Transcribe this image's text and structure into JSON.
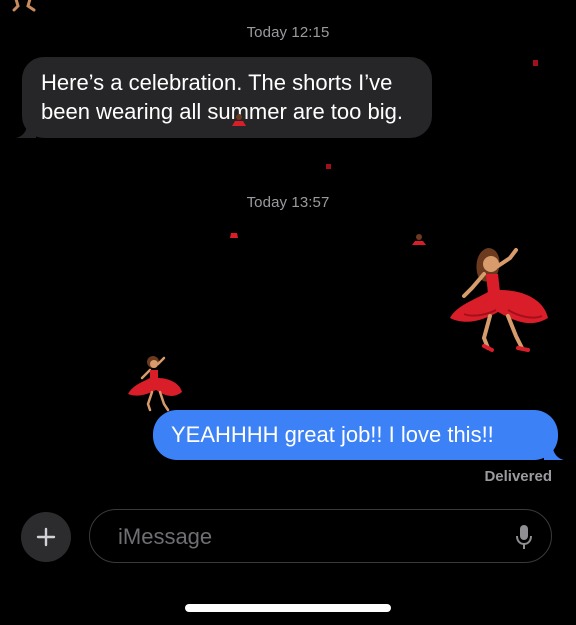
{
  "thread": {
    "timestamp_1": "Today 12:15",
    "incoming_message": "Here’s a celebration. The shorts I’ve been wearing all summer are too big.",
    "timestamp_2": "Today 13:57",
    "outgoing_message": "YEAHHHH great job!! I love this!!",
    "status": "Delivered"
  },
  "compose": {
    "placeholder": "iMessage"
  },
  "icons": {
    "plus": "plus-icon",
    "mic": "microphone-icon",
    "effect": "dancer-emoji-icon"
  },
  "colors": {
    "background": "#000000",
    "incoming_bubble": "#262628",
    "outgoing_bubble": "#3c82f6",
    "secondary_text": "#9a9a9f",
    "dancer_dress": "#d91e2a"
  }
}
